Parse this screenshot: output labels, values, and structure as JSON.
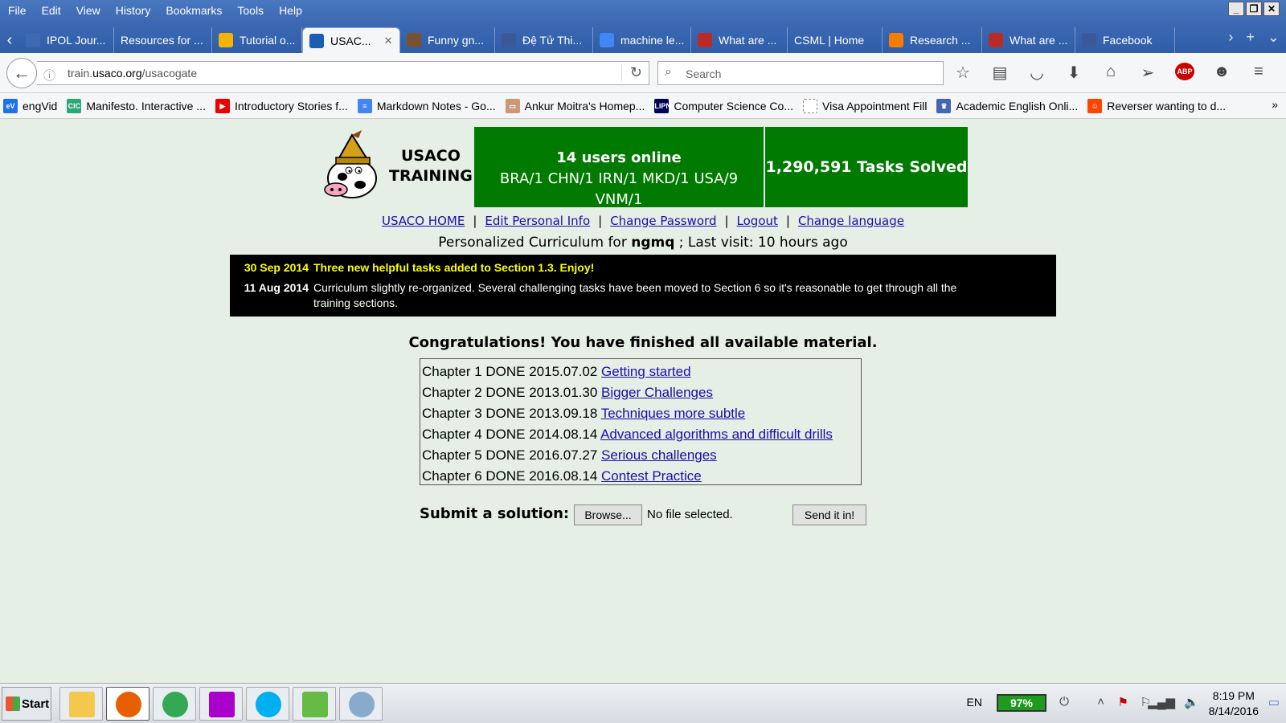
{
  "menu": [
    "File",
    "Edit",
    "View",
    "History",
    "Bookmarks",
    "Tools",
    "Help"
  ],
  "tabs": [
    {
      "label": "IPOL Jour...",
      "icon": "ipol-icon",
      "color": "#3d6ab3"
    },
    {
      "label": "Resources for ...",
      "icon": "none",
      "color": "#3d6ab3"
    },
    {
      "label": "Tutorial o...",
      "icon": "chart-icon",
      "color": "#f4b400"
    },
    {
      "label": "USAC...",
      "icon": "usaco-icon",
      "color": "#1a5fb4",
      "active": true
    },
    {
      "label": "Funny gn...",
      "icon": "cc-icon",
      "color": "#7a5230"
    },
    {
      "label": "Đệ Tử Thi...",
      "icon": "facebook-icon",
      "color": "#3b5998"
    },
    {
      "label": "machine le...",
      "icon": "google-icon",
      "color": "#4285f4"
    },
    {
      "label": "What are ...",
      "icon": "quora-icon",
      "color": "#b92b27"
    },
    {
      "label": "CSML | Home",
      "icon": "none",
      "color": "#3d6ab3"
    },
    {
      "label": "Research ...",
      "icon": "blogger-icon",
      "color": "#f57d00"
    },
    {
      "label": "What are ...",
      "icon": "quora-icon",
      "color": "#b92b27"
    },
    {
      "label": "Facebook",
      "icon": "facebook-icon",
      "color": "#3b5998"
    }
  ],
  "url": {
    "prefix": "train.",
    "domain": "usaco.org",
    "path": "/usacogate"
  },
  "search_placeholder": "Search",
  "bookmarks": [
    {
      "label": "engVid",
      "color": "#1a73e8",
      "abbr": "eV"
    },
    {
      "label": "Manifesto. Interactive ...",
      "color": "#2aa876",
      "abbr": "CIC"
    },
    {
      "label": "Introductory Stories f...",
      "color": "#e00",
      "abbr": "▶"
    },
    {
      "label": "Markdown Notes - Go...",
      "color": "#4285f4",
      "abbr": "≡"
    },
    {
      "label": "Ankur Moitra's Homep...",
      "color": "#c97",
      "abbr": "▭"
    },
    {
      "label": "Computer Science Co...",
      "color": "#005",
      "abbr": "LIPN"
    },
    {
      "label": "Visa Appointment Fill",
      "color": "#fff",
      "abbr": ""
    },
    {
      "label": "Academic English Onli...",
      "color": "#4464b4",
      "abbr": "♛"
    },
    {
      "label": "Reverser wanting to d...",
      "color": "#ff4500",
      "abbr": "☺"
    }
  ],
  "header": {
    "logo_line1": "USACO",
    "logo_line2": "TRAINING",
    "online_title": "14 users online",
    "online_countries": "BRA/1 CHN/1 IRN/1 MKD/1 USA/9 VNM/1",
    "tasks_solved": "1,290,591 Tasks Solved"
  },
  "links": [
    "USACO HOME",
    "Edit Personal Info",
    "Change Password",
    "Logout",
    "Change language"
  ],
  "curriculum": {
    "prefix": "Personalized Curriculum for ",
    "user": "ngmq",
    "suffix": " ; Last visit: 10 hours ago"
  },
  "news": [
    {
      "date": "30 Sep 2014",
      "text": "Three new helpful tasks added to Section 1.3. Enjoy!"
    },
    {
      "date": "11 Aug 2014",
      "text": "Curriculum slightly re-organized. Several challenging tasks have been moved to Section 6 so it's reasonable to get through all the training sections."
    }
  ],
  "congrats": "Congratulations! You have finished all available material.",
  "chapters": [
    {
      "prefix": "Chapter 1 DONE 2015.07.02 ",
      "link": "Getting started"
    },
    {
      "prefix": "Chapter 2 DONE 2013.01.30 ",
      "link": "Bigger Challenges"
    },
    {
      "prefix": "Chapter 3 DONE 2013.09.18 ",
      "link": "Techniques more subtle"
    },
    {
      "prefix": "Chapter 4 DONE 2014.08.14 ",
      "link": "Advanced algorithms and difficult drills"
    },
    {
      "prefix": "Chapter 5 DONE 2016.07.27 ",
      "link": "Serious challenges"
    },
    {
      "prefix": "Chapter 6 DONE 2016.08.14 ",
      "link": "Contest Practice"
    }
  ],
  "submit": {
    "label": "Submit a solution:",
    "browse": "Browse...",
    "no_file": "No file selected.",
    "send": "Send it in!"
  },
  "taskbar": {
    "start": "Start",
    "apps": [
      {
        "name": "explorer-icon",
        "color": "#f2c94c"
      },
      {
        "name": "firefox-icon",
        "color": "#e66000"
      },
      {
        "name": "chrome-icon",
        "color": "#34a853"
      },
      {
        "name": "winrar-icon",
        "color": "#a0c"
      },
      {
        "name": "skype-icon",
        "color": "#00aff0"
      },
      {
        "name": "notepad-icon",
        "color": "#6b4"
      },
      {
        "name": "paint-icon",
        "color": "#8ac"
      }
    ],
    "lang": "EN",
    "battery": "97%",
    "time": "8:19 PM",
    "date": "8/14/2016"
  }
}
